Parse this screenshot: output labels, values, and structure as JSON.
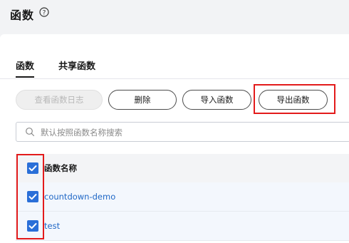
{
  "header": {
    "title": "函数"
  },
  "tabs": [
    {
      "label": "函数",
      "active": true
    },
    {
      "label": "共享函数",
      "active": false
    }
  ],
  "toolbar": {
    "view_logs_label": "查看函数日志",
    "delete_label": "删除",
    "import_label": "导入函数",
    "export_label": "导出函数"
  },
  "search": {
    "placeholder": "默认按照函数名称搜索",
    "value": ""
  },
  "table": {
    "header": {
      "name": "函数名称",
      "checked": true
    },
    "rows": [
      {
        "name": "countdown-demo",
        "checked": true
      },
      {
        "name": "test",
        "checked": true
      }
    ]
  },
  "colors": {
    "highlight": "#e31b1b",
    "checkbox": "#2a6fd8",
    "link": "#1f67c6"
  }
}
